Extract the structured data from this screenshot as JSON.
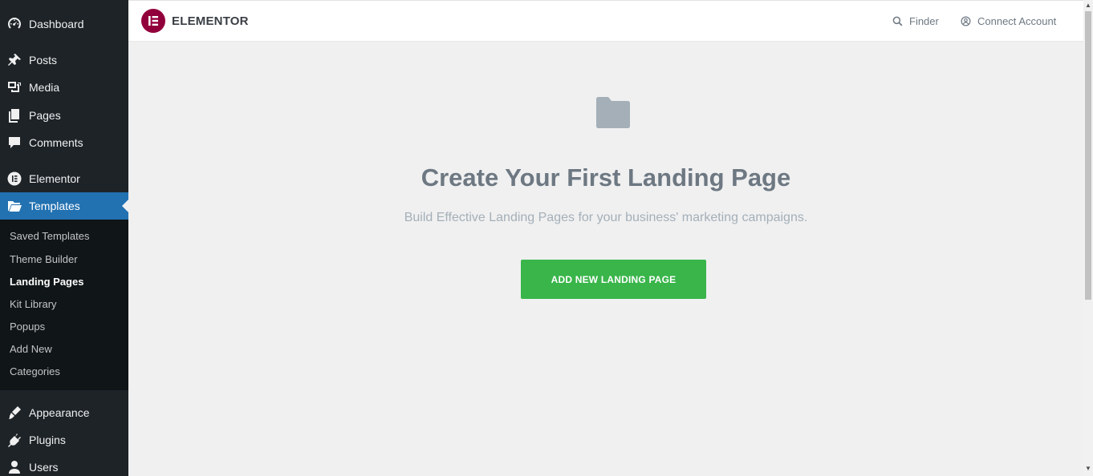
{
  "sidebar": {
    "top_items": [
      {
        "label": "Dashboard",
        "icon": "dashboard-icon"
      },
      {
        "label": "Posts",
        "icon": "pushpin-icon"
      },
      {
        "label": "Media",
        "icon": "media-icon"
      },
      {
        "label": "Pages",
        "icon": "pages-icon"
      },
      {
        "label": "Comments",
        "icon": "comment-icon"
      },
      {
        "label": "Elementor",
        "icon": "elementor-icon"
      },
      {
        "label": "Templates",
        "icon": "folder-open-icon"
      }
    ],
    "submenu": [
      {
        "label": "Saved Templates"
      },
      {
        "label": "Theme Builder"
      },
      {
        "label": "Landing Pages"
      },
      {
        "label": "Kit Library"
      },
      {
        "label": "Popups"
      },
      {
        "label": "Add New"
      },
      {
        "label": "Categories"
      }
    ],
    "bottom_items": [
      {
        "label": "Appearance",
        "icon": "brush-icon"
      },
      {
        "label": "Plugins",
        "icon": "plugin-icon"
      },
      {
        "label": "Users",
        "icon": "user-icon"
      }
    ],
    "active_item": "Templates",
    "current_submenu": "Landing Pages"
  },
  "header": {
    "brand": "ELEMENTOR",
    "finder_label": "Finder",
    "connect_label": "Connect Account"
  },
  "main": {
    "title": "Create Your First Landing Page",
    "subtitle": "Build Effective Landing Pages for your business' marketing campaigns.",
    "cta_label": "ADD NEW LANDING PAGE"
  },
  "colors": {
    "sidebar_bg": "#1d2327",
    "active_bg": "#2271b1",
    "elementor_brand": "#92003b",
    "cta_green": "#39b54a"
  }
}
